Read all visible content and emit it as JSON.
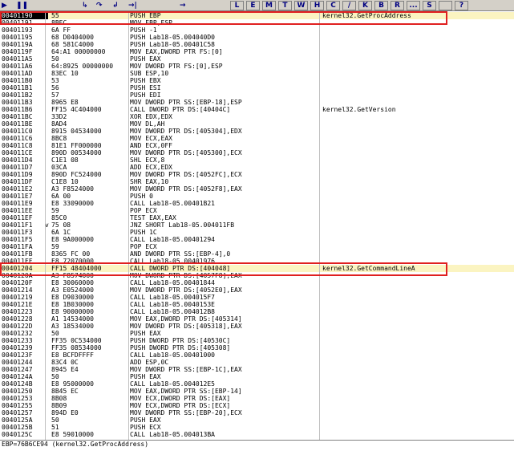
{
  "toolbar": {
    "buttons": [
      "▶",
      "❚❚",
      "↳",
      "↷",
      "↲",
      "→|",
      "→"
    ],
    "letters": [
      "L",
      "E",
      "M",
      "T",
      "W",
      "H",
      "C",
      "/",
      "K",
      "B",
      "R",
      "...",
      "S",
      "",
      "?"
    ]
  },
  "rows": [
    {
      "addr": "00401190",
      "flow": "",
      "hex": "55",
      "dis": "PUSH EBP",
      "com": "kernel32.GetProcAddress",
      "sel": true
    },
    {
      "addr": "00401191",
      "flow": "",
      "hex": "8BEC",
      "dis": "MOV EBP,ESP",
      "com": ""
    },
    {
      "addr": "00401193",
      "flow": "",
      "hex": "6A FF",
      "dis": "PUSH -1",
      "com": ""
    },
    {
      "addr": "00401195",
      "flow": "",
      "hex": "68 D0404000",
      "dis": "PUSH Lab18-05.004040D0",
      "com": ""
    },
    {
      "addr": "0040119A",
      "flow": "",
      "hex": "68 581C4000",
      "dis": "PUSH Lab18-05.00401C58",
      "com": ""
    },
    {
      "addr": "0040119F",
      "flow": "",
      "hex": "64:A1 00000000",
      "dis": "MOV EAX,DWORD PTR FS:[0]",
      "com": ""
    },
    {
      "addr": "004011A5",
      "flow": "",
      "hex": "50",
      "dis": "PUSH EAX",
      "com": ""
    },
    {
      "addr": "004011A6",
      "flow": "",
      "hex": "64:8925 00000000",
      "dis": "MOV DWORD PTR FS:[0],ESP",
      "com": ""
    },
    {
      "addr": "004011AD",
      "flow": "",
      "hex": "83EC 10",
      "dis": "SUB ESP,10",
      "com": ""
    },
    {
      "addr": "004011B0",
      "flow": "",
      "hex": "53",
      "dis": "PUSH EBX",
      "com": ""
    },
    {
      "addr": "004011B1",
      "flow": "",
      "hex": "56",
      "dis": "PUSH ESI",
      "com": ""
    },
    {
      "addr": "004011B2",
      "flow": "",
      "hex": "57",
      "dis": "PUSH EDI",
      "com": ""
    },
    {
      "addr": "004011B3",
      "flow": "",
      "hex": "8965 E8",
      "dis": "MOV DWORD PTR SS:[EBP-18],ESP",
      "com": ""
    },
    {
      "addr": "004011B6",
      "flow": "",
      "hex": "FF15 4C404000",
      "dis": "CALL DWORD PTR DS:[40404C]",
      "com": "kernel32.GetVersion"
    },
    {
      "addr": "004011BC",
      "flow": "",
      "hex": "33D2",
      "dis": "XOR EDX,EDX",
      "com": ""
    },
    {
      "addr": "004011BE",
      "flow": "",
      "hex": "8AD4",
      "dis": "MOV DL,AH",
      "com": ""
    },
    {
      "addr": "004011C0",
      "flow": "",
      "hex": "8915 04534000",
      "dis": "MOV DWORD PTR DS:[405304],EDX",
      "com": ""
    },
    {
      "addr": "004011C6",
      "flow": "",
      "hex": "8BC8",
      "dis": "MOV ECX,EAX",
      "com": ""
    },
    {
      "addr": "004011C8",
      "flow": "",
      "hex": "81E1 FF000000",
      "dis": "AND ECX,0FF",
      "com": ""
    },
    {
      "addr": "004011CE",
      "flow": "",
      "hex": "890D 00534000",
      "dis": "MOV DWORD PTR DS:[405300],ECX",
      "com": ""
    },
    {
      "addr": "004011D4",
      "flow": "",
      "hex": "C1E1 08",
      "dis": "SHL ECX,8",
      "com": ""
    },
    {
      "addr": "004011D7",
      "flow": "",
      "hex": "03CA",
      "dis": "ADD ECX,EDX",
      "com": ""
    },
    {
      "addr": "004011D9",
      "flow": "",
      "hex": "890D FC524000",
      "dis": "MOV DWORD PTR DS:[4052FC],ECX",
      "com": ""
    },
    {
      "addr": "004011DF",
      "flow": "",
      "hex": "C1E8 10",
      "dis": "SHR EAX,10",
      "com": ""
    },
    {
      "addr": "004011E2",
      "flow": "",
      "hex": "A3 F8524000",
      "dis": "MOV DWORD PTR DS:[4052F8],EAX",
      "com": ""
    },
    {
      "addr": "004011E7",
      "flow": "",
      "hex": "6A 00",
      "dis": "PUSH 0",
      "com": ""
    },
    {
      "addr": "004011E9",
      "flow": "",
      "hex": "E8 33090000",
      "dis": "CALL Lab18-05.00401B21",
      "com": ""
    },
    {
      "addr": "004011EE",
      "flow": "",
      "hex": "59",
      "dis": "POP ECX",
      "com": ""
    },
    {
      "addr": "004011EF",
      "flow": "",
      "hex": "85C0",
      "dis": "TEST EAX,EAX",
      "com": ""
    },
    {
      "addr": "004011F1",
      "flow": "v",
      "hex": "75 08",
      "dis": "JNZ SHORT Lab18-05.004011FB",
      "com": ""
    },
    {
      "addr": "004011F3",
      "flow": "",
      "hex": "6A 1C",
      "dis": "PUSH 1C",
      "com": ""
    },
    {
      "addr": "004011F5",
      "flow": "",
      "hex": "E8 9A000000",
      "dis": "CALL Lab18-05.00401294",
      "com": ""
    },
    {
      "addr": "004011FA",
      "flow": "",
      "hex": "59",
      "dis": "POP ECX",
      "com": ""
    },
    {
      "addr": "004011FB",
      "flow": "",
      "hex": "8365 FC 00",
      "dis": "AND DWORD PTR SS:[EBP-4],0",
      "com": ""
    },
    {
      "addr": "004011FF",
      "flow": "",
      "hex": "E8 72070000",
      "dis": "CALL Lab18-05.00401976",
      "com": ""
    },
    {
      "addr": "00401204",
      "flow": "",
      "hex": "FF15 48404000",
      "dis": "CALL DWORD PTR DS:[404048]",
      "com": "kernel32.GetCommandLineA",
      "hl": true
    },
    {
      "addr": "0040120A",
      "flow": "",
      "hex": "A3 F8574000",
      "dis": "MOV DWORD PTR DS:[4057F8],EAX",
      "com": ""
    },
    {
      "addr": "0040120F",
      "flow": "",
      "hex": "E8 30060000",
      "dis": "CALL Lab18-05.00401844",
      "com": ""
    },
    {
      "addr": "00401214",
      "flow": "",
      "hex": "A3 E0524000",
      "dis": "MOV DWORD PTR DS:[4052E0],EAX",
      "com": ""
    },
    {
      "addr": "00401219",
      "flow": "",
      "hex": "E8 D9030000",
      "dis": "CALL Lab18-05.004015F7",
      "com": ""
    },
    {
      "addr": "0040121E",
      "flow": "",
      "hex": "E8 1B030000",
      "dis": "CALL Lab18-05.0040153E",
      "com": ""
    },
    {
      "addr": "00401223",
      "flow": "",
      "hex": "E8 90000000",
      "dis": "CALL Lab18-05.004012B8",
      "com": ""
    },
    {
      "addr": "00401228",
      "flow": "",
      "hex": "A1 14534000",
      "dis": "MOV EAX,DWORD PTR DS:[405314]",
      "com": ""
    },
    {
      "addr": "0040122D",
      "flow": "",
      "hex": "A3 18534000",
      "dis": "MOV DWORD PTR DS:[405318],EAX",
      "com": ""
    },
    {
      "addr": "00401232",
      "flow": "",
      "hex": "50",
      "dis": "PUSH EAX",
      "com": ""
    },
    {
      "addr": "00401233",
      "flow": "",
      "hex": "FF35 0C534000",
      "dis": "PUSH DWORD PTR DS:[40530C]",
      "com": ""
    },
    {
      "addr": "00401239",
      "flow": "",
      "hex": "FF35 08534000",
      "dis": "PUSH DWORD PTR DS:[405308]",
      "com": ""
    },
    {
      "addr": "0040123F",
      "flow": "",
      "hex": "E8 BCFDFFFF",
      "dis": "CALL Lab18-05.00401000",
      "com": ""
    },
    {
      "addr": "00401244",
      "flow": "",
      "hex": "83C4 0C",
      "dis": "ADD ESP,0C",
      "com": ""
    },
    {
      "addr": "00401247",
      "flow": "",
      "hex": "8945 E4",
      "dis": "MOV DWORD PTR SS:[EBP-1C],EAX",
      "com": ""
    },
    {
      "addr": "0040124A",
      "flow": "",
      "hex": "50",
      "dis": "PUSH EAX",
      "com": ""
    },
    {
      "addr": "0040124B",
      "flow": "",
      "hex": "E8 95000000",
      "dis": "CALL Lab18-05.004012E5",
      "com": ""
    },
    {
      "addr": "00401250",
      "flow": "",
      "hex": "8B45 EC",
      "dis": "MOV EAX,DWORD PTR SS:[EBP-14]",
      "com": ""
    },
    {
      "addr": "00401253",
      "flow": "",
      "hex": "8B08",
      "dis": "MOV ECX,DWORD PTR DS:[EAX]",
      "com": ""
    },
    {
      "addr": "00401255",
      "flow": "",
      "hex": "8B09",
      "dis": "MOV ECX,DWORD PTR DS:[ECX]",
      "com": ""
    },
    {
      "addr": "00401257",
      "flow": "",
      "hex": "894D E0",
      "dis": "MOV DWORD PTR SS:[EBP-20],ECX",
      "com": ""
    },
    {
      "addr": "0040125A",
      "flow": "",
      "hex": "50",
      "dis": "PUSH EAX",
      "com": ""
    },
    {
      "addr": "0040125B",
      "flow": "",
      "hex": "51",
      "dis": "PUSH ECX",
      "com": ""
    },
    {
      "addr": "0040125C",
      "flow": "",
      "hex": "E8 59010000",
      "dis": "CALL Lab18-05.004013BA",
      "com": ""
    }
  ],
  "info": {
    "text": "EBP=76B6CE94 (kernel32.GetProcAddress)"
  }
}
